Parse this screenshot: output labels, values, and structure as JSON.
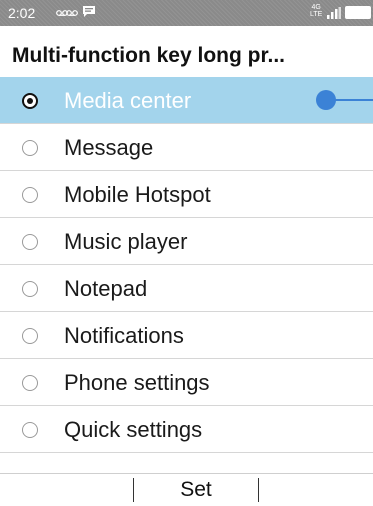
{
  "status_bar": {
    "time": "2:02",
    "network": "4G",
    "network_sub": "LTE",
    "icons": [
      "voicemail-icon",
      "voicemail-icon",
      "message-icon",
      "signal-icon",
      "battery-icon"
    ]
  },
  "title": "Multi-function key long pr...",
  "options": [
    {
      "label": "Media center",
      "selected": true
    },
    {
      "label": "Message",
      "selected": false
    },
    {
      "label": "Mobile Hotspot",
      "selected": false
    },
    {
      "label": "Music player",
      "selected": false
    },
    {
      "label": "Notepad",
      "selected": false
    },
    {
      "label": "Notifications",
      "selected": false
    },
    {
      "label": "Phone settings",
      "selected": false
    },
    {
      "label": "Quick settings",
      "selected": false
    }
  ],
  "softkeys": {
    "left": "",
    "center": "Set",
    "right": ""
  },
  "colors": {
    "selected_row": "#a3d4ec",
    "accent": "#3b82d6",
    "status_bar": "#8a8a8a"
  }
}
